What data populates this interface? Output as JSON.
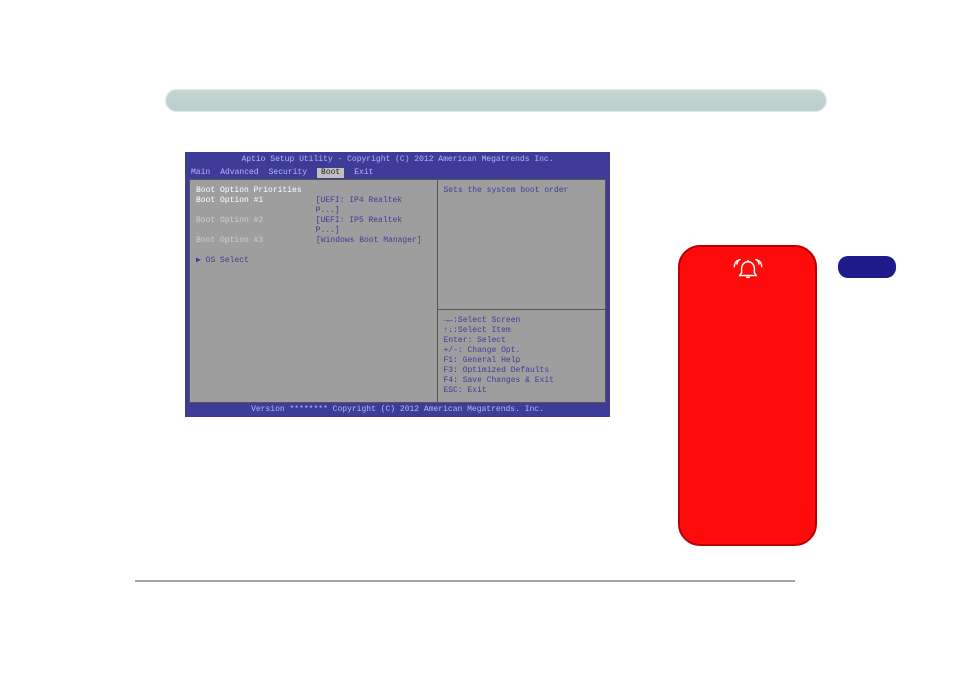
{
  "bios": {
    "title": "Aptio Setup Utility - Copyright (C) 2012 American Megatrends Inc.",
    "menu": [
      "Main",
      "Advanced",
      "Security",
      "Boot",
      "Exit"
    ],
    "active_menu_index": 3,
    "left": {
      "heading": "Boot Option Priorities",
      "rows": [
        {
          "label": "Boot Option #1",
          "value": "[UEFI: IP4 Realtek P...]",
          "highlight": true
        },
        {
          "label": "Boot Option #2",
          "value": "[UEFI: IP5 Realtek P...]",
          "highlight": false
        },
        {
          "label": "Boot Option #3",
          "value": "[Windows Boot Manager]",
          "highlight": false
        }
      ],
      "os_select_prefix": "▶",
      "os_select": "OS Select"
    },
    "help": "Sets the system boot order",
    "keys": [
      "→←:Select Screen",
      "↑↓:Select Item",
      "Enter: Select",
      "+/-: Change Opt.",
      "F1: General Help",
      "F3: Optimized Defaults",
      "F4: Save Changes & Exit",
      "ESC: Exit"
    ],
    "footer": "Version ******** Copyright (C) 2012 American Megatrends. Inc."
  },
  "icons": {
    "warning_bell": "alarm-bell-icon"
  }
}
